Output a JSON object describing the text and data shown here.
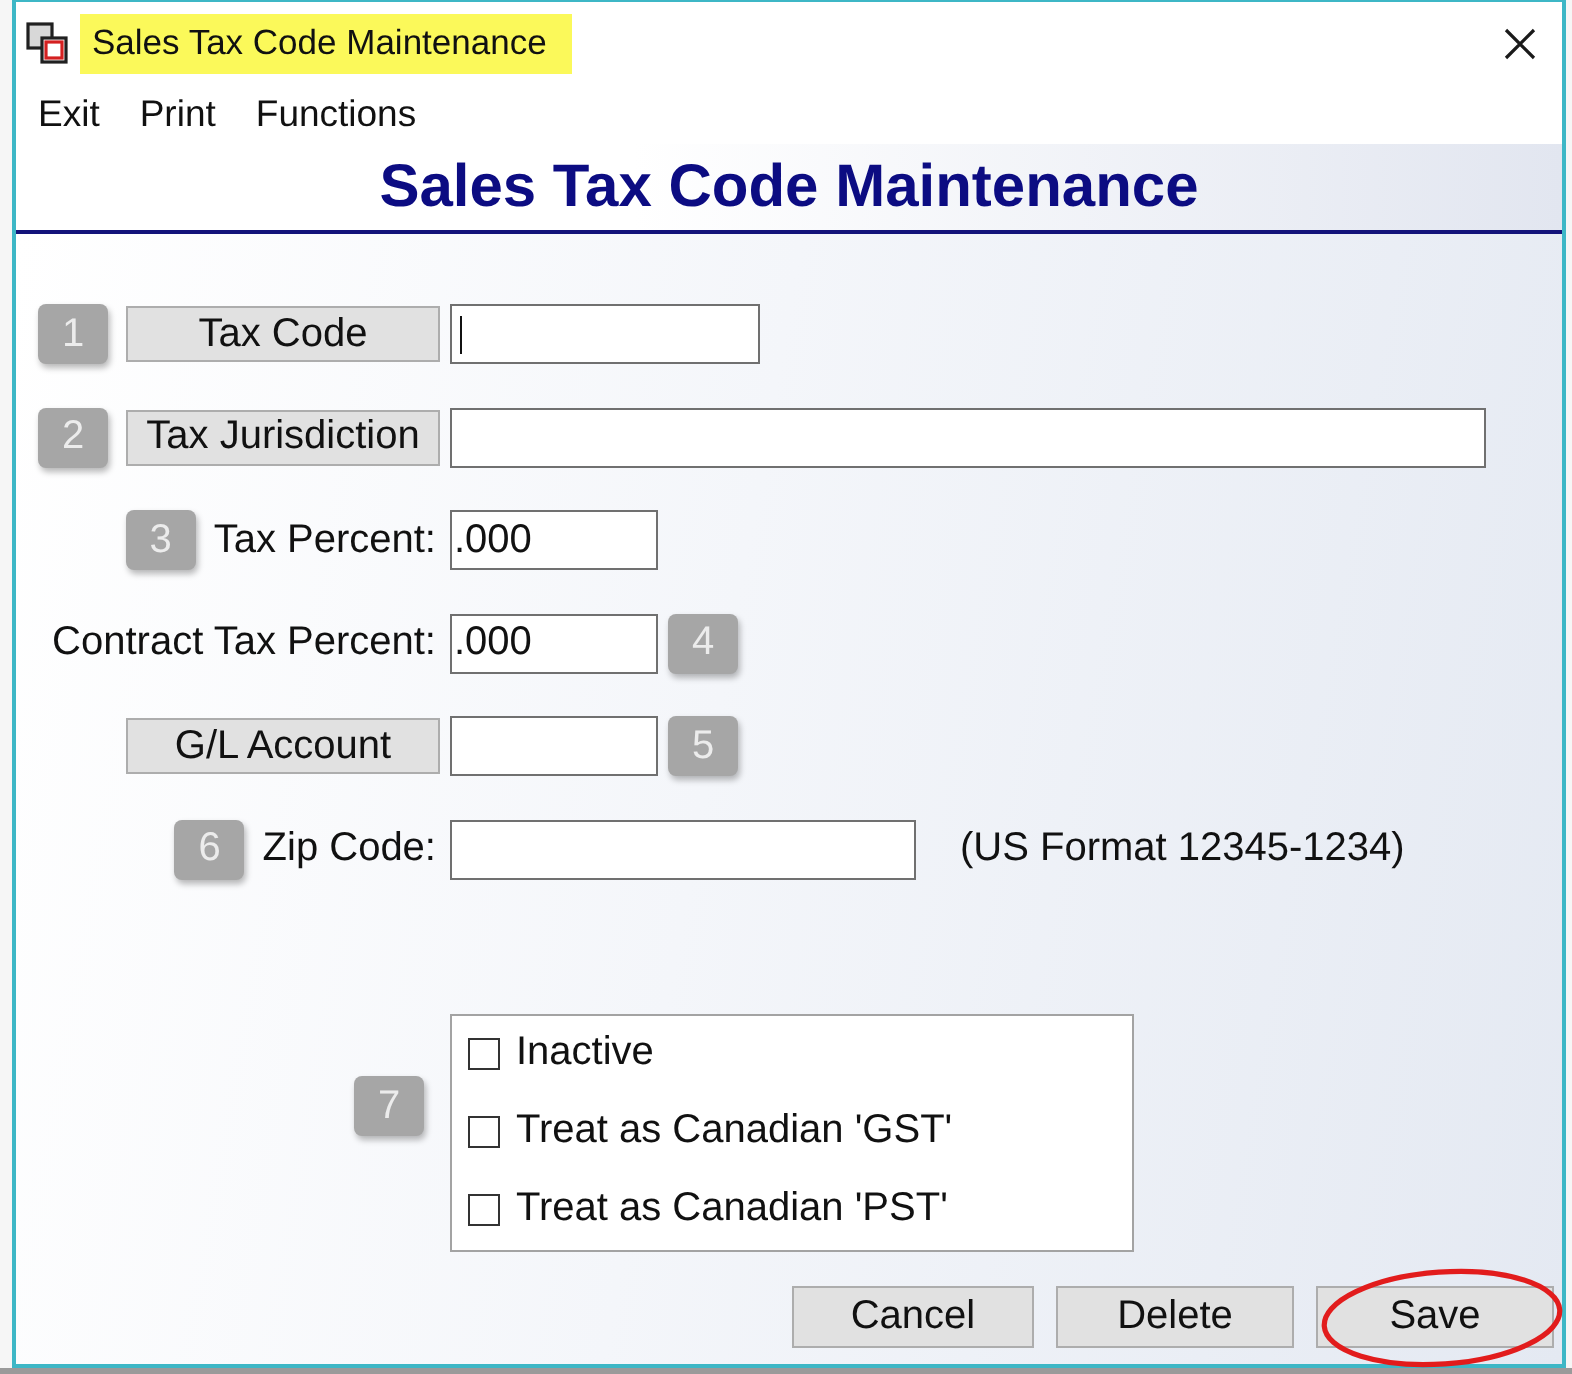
{
  "window": {
    "title": "Sales Tax Code Maintenance",
    "title_highlighted": true
  },
  "menu": [
    {
      "label": "Exit"
    },
    {
      "label": "Print"
    },
    {
      "label": "Functions"
    }
  ],
  "header": {
    "title": "Sales Tax Code Maintenance"
  },
  "fields": [
    {
      "step": {
        "kind": "leading",
        "number": "1"
      },
      "kind": "button",
      "label": "Tax Code",
      "focused": true
    },
    {
      "step": {
        "kind": "leading",
        "number": "2"
      },
      "kind": "button",
      "label": "Tax Jurisdiction",
      "focused": false
    },
    {
      "step": {
        "kind": "leading",
        "number": "3"
      },
      "kind": "text",
      "label": "Tax Percent:",
      "value": ".000",
      "focused": false
    },
    {
      "step": {
        "kind": "trailing",
        "number": "4"
      },
      "kind": "text",
      "label": "Contract Tax Percent:",
      "value": ".000",
      "focused": false
    },
    {
      "step": {
        "kind": "trailing",
        "number": "5"
      },
      "kind": "button",
      "label": "G/L Account",
      "focused": false
    },
    {
      "step": {
        "kind": "leading",
        "number": "6"
      },
      "kind": "text",
      "label": "Zip Code:",
      "hint": "(US Format 12345-1234)",
      "focused": false
    }
  ],
  "options": {
    "number": "7",
    "items": [
      {
        "label": "Inactive",
        "checked": false
      },
      {
        "label": "Treat as Canadian 'GST'",
        "checked": false
      },
      {
        "label": "Treat as Canadian 'PST'",
        "checked": false
      }
    ]
  },
  "buttons": [
    {
      "label": "Cancel",
      "circled": false
    },
    {
      "label": "Delete",
      "circled": false
    },
    {
      "label": "Save",
      "circled": true
    }
  ]
}
